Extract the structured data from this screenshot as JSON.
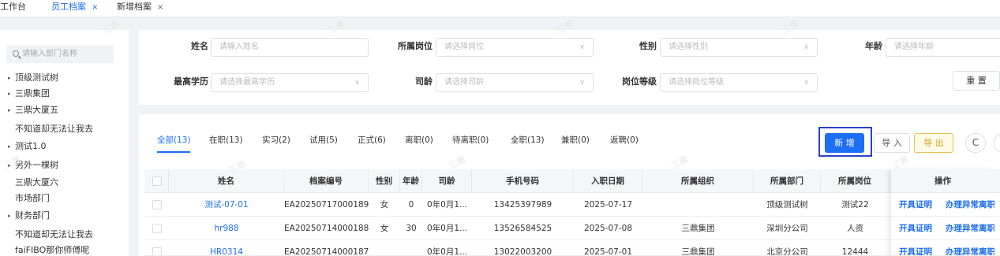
{
  "tabs": [
    {
      "label": "工作台",
      "close": "",
      "active": false
    },
    {
      "label": "员工档案",
      "close": "×",
      "active": true
    },
    {
      "label": "新增档案",
      "close": "×",
      "active": false
    }
  ],
  "watermark": "三鼎",
  "sidebar": {
    "search_placeholder": "请输入部门名称",
    "tree": [
      {
        "label": "顶级测试树",
        "arrow": "▸"
      },
      {
        "label": "三鼎集团",
        "arrow": "▸"
      },
      {
        "label": "三鼎大厦五",
        "arrow": "▸"
      },
      {
        "label": "不知道却无法让我去",
        "arrow": ""
      },
      {
        "label": "测试1.0",
        "arrow": "▸"
      },
      {
        "label": "另外一棵树",
        "arrow": "▸"
      },
      {
        "label": "三鼎大厦六",
        "arrow": ""
      },
      {
        "label": "市场部门",
        "arrow": ""
      },
      {
        "label": "财务部门",
        "arrow": "▸"
      },
      {
        "label": "不知道却无法让我去",
        "arrow": ""
      },
      {
        "label": "faiFIBO那你师傅呢",
        "arrow": ""
      }
    ]
  },
  "filters": {
    "name": {
      "label": "姓名",
      "placeholder": "请输入姓名"
    },
    "post": {
      "label": "所属岗位",
      "placeholder": "请选择岗位"
    },
    "gender": {
      "label": "性别",
      "placeholder": "请选择性别"
    },
    "age": {
      "label": "年龄",
      "placeholder": "请选择年龄"
    },
    "education": {
      "label": "最高学历",
      "placeholder": "请选择最高学历"
    },
    "seniority": {
      "label": "司龄",
      "placeholder": "请选择司龄"
    },
    "level": {
      "label": "岗位等级",
      "placeholder": "请选择岗位等级"
    },
    "reset_label": "重 置",
    "chevron": "∨"
  },
  "status_tabs": [
    {
      "label": "全部(13)",
      "active": true
    },
    {
      "label": "在职(13)",
      "active": false
    },
    {
      "label": "实习(2)",
      "active": false
    },
    {
      "label": "试用(5)",
      "active": false
    },
    {
      "label": "正式(6)",
      "active": false
    },
    {
      "label": "离职(0)",
      "active": false
    },
    {
      "label": "待离职(0)",
      "active": false
    },
    {
      "label": "全职(13)",
      "active": false
    },
    {
      "label": "兼职(0)",
      "active": false
    },
    {
      "label": "返聘(0)",
      "active": false
    }
  ],
  "actions": {
    "add": "新 增",
    "import": "导 入",
    "export": "导 出",
    "refresh": "C"
  },
  "table": {
    "headers": [
      "姓名",
      "档案编号",
      "性别",
      "年龄",
      "司龄",
      "手机号码",
      "入职日期",
      "所属组织",
      "所属部门",
      "所属岗位",
      "操作"
    ],
    "rows": [
      [
        "测试-07-01",
        "EA20250717000189",
        "女",
        "0",
        "0年0月1...",
        "13425397989",
        "2025-07-17",
        "",
        "顶级测试树",
        "测试22"
      ],
      [
        "hr988",
        "EA20250714000188",
        "女",
        "30",
        "0年0月1...",
        "13526584525",
        "2025-07-08",
        "三鼎集团",
        "深圳分公司",
        "人资"
      ],
      [
        "HR0314",
        "EA20250714000187",
        "",
        "",
        "0年0月1...",
        "13022003200",
        "2025-07-01",
        "三鼎集团",
        "北京分公司",
        "12444"
      ]
    ],
    "op_certificate": "开具证明",
    "op_abnormal": "办理异常离职"
  },
  "colors": {
    "primary": "#1c6ef2",
    "export": "#d6a21a",
    "highlight_frame": "#2b3fcf"
  }
}
